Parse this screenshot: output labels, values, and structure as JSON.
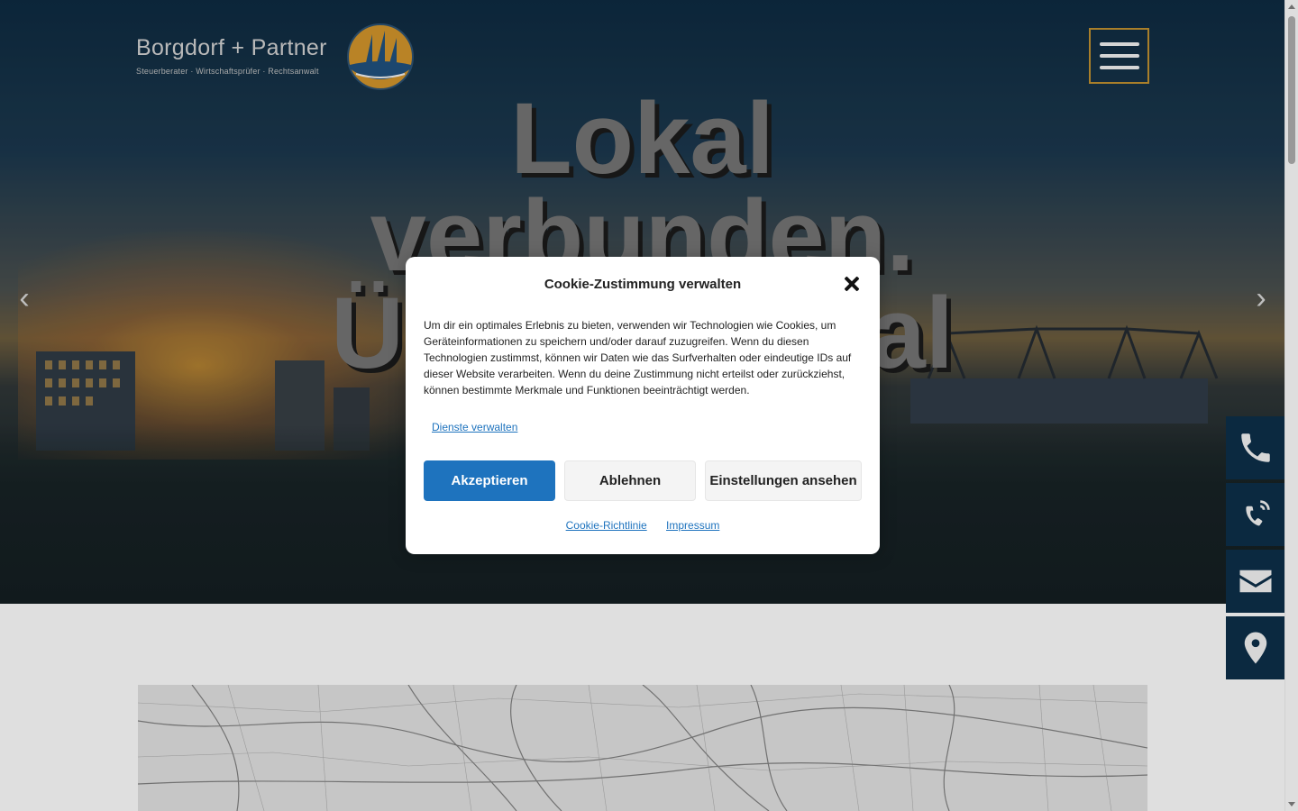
{
  "header": {
    "logo_name": "Borgdorf + Partner",
    "logo_subtitle": "Steuerberater · Wirtschaftsprüfer · Rechtsanwalt"
  },
  "hero": {
    "title_lines": [
      "Lokal",
      "verbunden.",
      "Überregional"
    ]
  },
  "cookie_modal": {
    "title": "Cookie-Zustimmung verwalten",
    "text": "Um dir ein optimales Erlebnis zu bieten, verwenden wir Technologien wie Cookies, um Geräteinformationen zu speichern und/oder darauf zuzugreifen. Wenn du diesen Technologien zustimmst, können wir Daten wie das Surfverhalten oder eindeutige IDs auf dieser Website verarbeiten. Wenn du deine Zustimmung nicht erteilst oder zurückziehst, können bestimmte Merkmale und Funktionen beeinträchtigt werden.",
    "manage_link": "Dienste verwalten",
    "accept_label": "Akzeptieren",
    "deny_label": "Ablehnen",
    "settings_label": "Einstellungen ansehen",
    "policy_link": "Cookie-Richtlinie",
    "imprint_link": "Impressum"
  },
  "side_bar": {
    "icons": [
      "phone-icon",
      "phone-ringing-icon",
      "mail-icon",
      "location-pin-icon"
    ]
  },
  "colors": {
    "accent_blue": "#1e73be",
    "side_bar_bg": "#0d2d46",
    "menu_border": "#b88a2e"
  }
}
